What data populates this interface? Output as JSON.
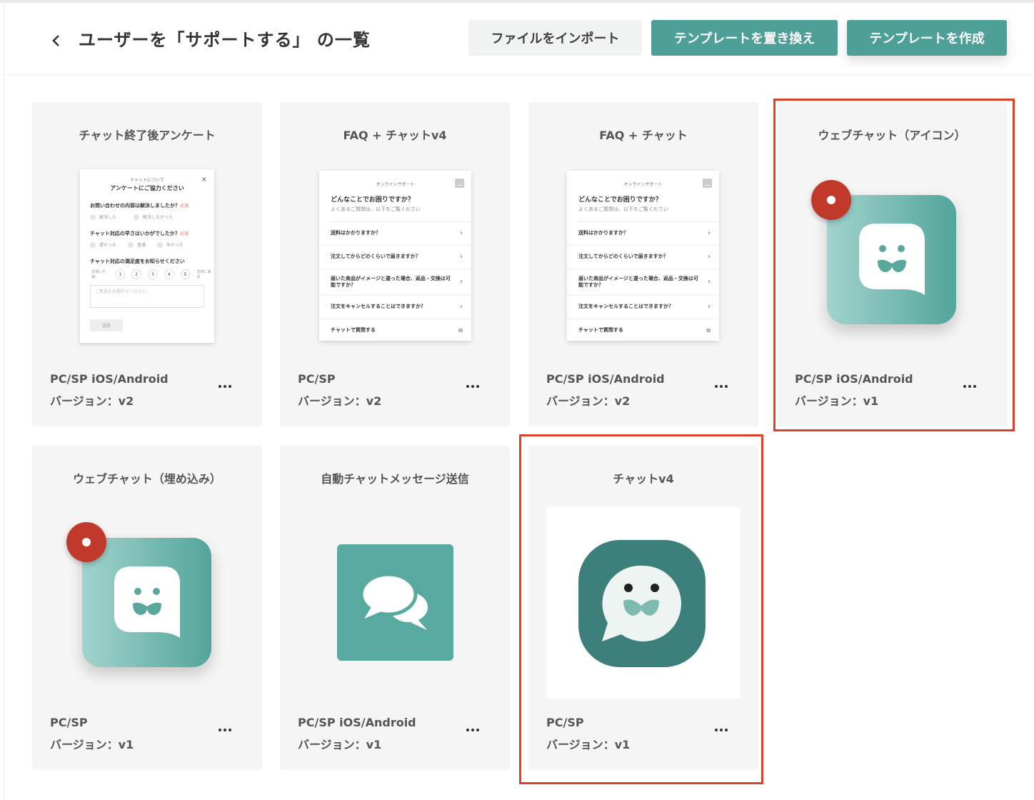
{
  "header": {
    "title": "ユーザーを「サポートする」 の一覧",
    "buttons": {
      "import": "ファイルをインポート",
      "replace": "テンプレートを置き換え",
      "create": "テンプレートを作成"
    }
  },
  "colors": {
    "primary": "#4e9f98",
    "highlight": "#d9432e",
    "badge": "#c0392b",
    "card_bg": "#f5f5f5"
  },
  "cards": [
    {
      "title": "チャット終了後アンケート",
      "platform": "PC/SP iOS/Android",
      "version": "バージョン：v2",
      "preview": "survey-form"
    },
    {
      "title": "FAQ + チャットv4",
      "platform": "PC/SP",
      "version": "バージョン：v2",
      "preview": "faq-panel"
    },
    {
      "title": "FAQ + チャット",
      "platform": "PC/SP iOS/Android",
      "version": "バージョン：v2",
      "preview": "faq-panel"
    },
    {
      "title": "ウェブチャット（アイコン）",
      "platform": "PC/SP iOS/Android",
      "version": "バージョン：v1",
      "preview": "chat-app-icon",
      "highlighted": true
    },
    {
      "title": "ウェブチャット（埋め込み）",
      "platform": "PC/SP",
      "version": "バージョン：v1",
      "preview": "chat-app-icon"
    },
    {
      "title": "自動チャットメッセージ送信",
      "platform": "PC/SP iOS/Android",
      "version": "バージョン：v1",
      "preview": "speech-bubbles-icon"
    },
    {
      "title": "チャットv4",
      "platform": "PC/SP",
      "version": "バージョン：v1",
      "preview": "chat-v4-icon",
      "highlighted": true
    }
  ],
  "survey": {
    "top": "チャットについて",
    "heading": "アンケートにご協力ください",
    "close": "×",
    "q1": "お問い合わせの内容は解決しましたか？",
    "q1_opts": [
      "解決した",
      "解決しなかった"
    ],
    "q2": "チャット対応の早さはいかがでしたか？",
    "q2_opts": [
      "遅かった",
      "普通",
      "早かった"
    ],
    "q3": "チャット対応の満足度をお知らせください",
    "required": "必須",
    "scale": [
      "1",
      "2",
      "3",
      "4",
      "5"
    ],
    "scale_low": "非常に不満",
    "scale_high": "非常に満足",
    "placeholder": "ご意見をお聞かせください",
    "send": "送信"
  },
  "faq": {
    "top": "オンラインサポート",
    "heading": "どんなことでお困りですか？",
    "sub": "よくあるご質問は、以下をご覧ください",
    "rows": [
      "送料はかかりますか？",
      "注文してからどのくらいで届きますか？",
      "届いた商品がイメージと違った場合、返品・交換は可能ですか？",
      "注文をキャンセルすることはできますか？",
      "チャットで質問する"
    ]
  }
}
